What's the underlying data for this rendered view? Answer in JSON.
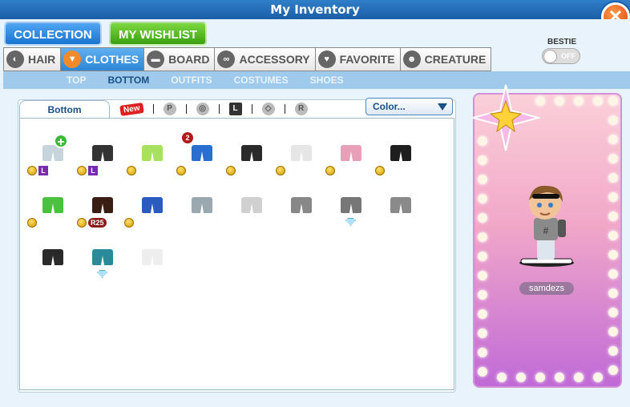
{
  "window": {
    "title": "My Inventory"
  },
  "buttons": {
    "collection": "COLLECTION",
    "wishlist": "MY WISHLIST"
  },
  "categories": [
    {
      "label": "HAIR",
      "icon": "hair-icon",
      "active": false
    },
    {
      "label": "CLOTHES",
      "icon": "shirt-icon",
      "active": true
    },
    {
      "label": "BOARD",
      "icon": "board-icon",
      "active": false
    },
    {
      "label": "ACCESSORY",
      "icon": "glasses-icon",
      "active": false
    },
    {
      "label": "FAVORITE",
      "icon": "heart-icon",
      "active": false
    },
    {
      "label": "CREATURE",
      "icon": "creature-icon",
      "active": false
    }
  ],
  "bestie": {
    "label": "BESTIE",
    "toggle": "OFF"
  },
  "subnav": [
    "TOP",
    "BOTTOM",
    "OUTFITS",
    "COSTUMES",
    "SHOES"
  ],
  "subnav_active": "BOTTOM",
  "filter_tab": "Bottom",
  "filters": {
    "new_badge": "New",
    "p": "P",
    "l": "L",
    "r": "R"
  },
  "color_select": "Color...",
  "items": [
    {
      "row": 0,
      "col": 0,
      "color": "#c8d4dc",
      "tags": [
        "coin",
        "L"
      ],
      "plus": true
    },
    {
      "row": 0,
      "col": 1,
      "color": "#333333",
      "tags": [
        "coin",
        "L"
      ]
    },
    {
      "row": 0,
      "col": 2,
      "color": "#a8e060",
      "tags": [
        "coin"
      ]
    },
    {
      "row": 0,
      "col": 3,
      "color": "#2a6fd0",
      "tags": [
        "coin"
      ],
      "count": "2"
    },
    {
      "row": 0,
      "col": 4,
      "color": "#2a2a2a",
      "tags": [
        "coin"
      ]
    },
    {
      "row": 0,
      "col": 5,
      "color": "#e6e6e6",
      "tags": [
        "coin"
      ]
    },
    {
      "row": 0,
      "col": 6,
      "color": "#e8a0b8",
      "tags": [
        "coin"
      ]
    },
    {
      "row": 0,
      "col": 7,
      "color": "#1e1e1e",
      "tags": [
        "coin"
      ]
    },
    {
      "row": 1,
      "col": 0,
      "color": "#4cc040",
      "tags": [
        "coin"
      ]
    },
    {
      "row": 1,
      "col": 1,
      "color": "#3a1e14",
      "tags": [
        "coin",
        "R25",
        "coin2"
      ]
    },
    {
      "row": 1,
      "col": 2,
      "color": "#2a5cc0",
      "tags": []
    },
    {
      "row": 1,
      "col": 3,
      "color": "#9aa8b0",
      "tags": []
    },
    {
      "row": 1,
      "col": 4,
      "color": "#d0d0d0",
      "tags": []
    },
    {
      "row": 1,
      "col": 5,
      "color": "#888888",
      "tags": []
    },
    {
      "row": 1,
      "col": 6,
      "color": "#777777",
      "tags": [
        "gem"
      ]
    },
    {
      "row": 1,
      "col": 7,
      "color": "#8a8a8a",
      "tags": []
    },
    {
      "row": 2,
      "col": 0,
      "color": "#2a2a2a",
      "tags": []
    },
    {
      "row": 2,
      "col": 1,
      "color": "#2a8a9a",
      "tags": [
        "gem"
      ]
    },
    {
      "row": 2,
      "col": 2,
      "color": "#eeeeee",
      "tags": []
    }
  ],
  "item_tags": {
    "L": "L",
    "R25": "R25"
  },
  "avatar": {
    "name": "samdezs"
  }
}
